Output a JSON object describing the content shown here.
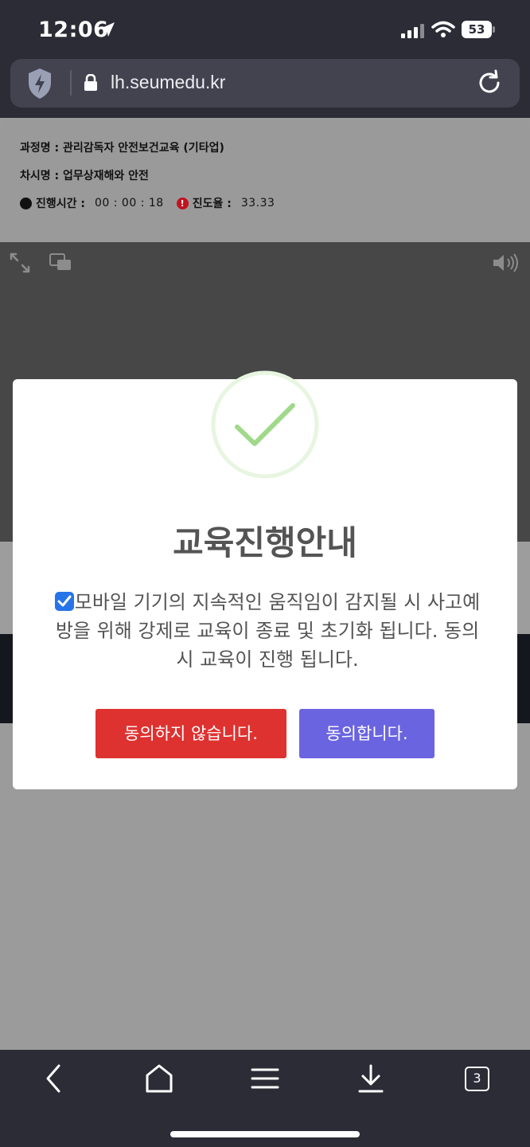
{
  "status_bar": {
    "time": "12:06",
    "battery": "53"
  },
  "browser": {
    "url": "lh.seumedu.kr",
    "open_tabs": "3"
  },
  "course": {
    "course_line": "과정명 : 관리감독자 안전보건교육 (기타업)",
    "lesson_line": "차시명 : 업무상재해와 안전",
    "elapsed_label": "진행시간 :",
    "elapsed_value": "00 : 00 : 18",
    "progress_label": "진도율 :",
    "progress_value": "33.33"
  },
  "modal": {
    "title": "교육진행안내",
    "message": "모바일 기기의 지속적인 움직임이 감지될 시 사고예방을 위해 강제로 교육이 종료 및 초기화 됩니다. 동의시 교육이 진행 됩니다.",
    "agree_checked": true,
    "disagree_label": "동의하지 않습니다.",
    "agree_label": "동의합니다."
  },
  "colors": {
    "disagree": "#de3230",
    "agree": "#6b64e0",
    "success": "#a0d98a",
    "chrome": "#2c2c37"
  },
  "icons": [
    "location-arrow-icon",
    "signal-icon",
    "wifi-icon",
    "battery-icon",
    "shield-icon",
    "lock-icon",
    "reload-icon",
    "expand-icon",
    "pip-icon",
    "volume-icon",
    "success-check-icon",
    "back-icon",
    "home-icon",
    "menu-icon",
    "download-icon",
    "tabs-icon"
  ]
}
